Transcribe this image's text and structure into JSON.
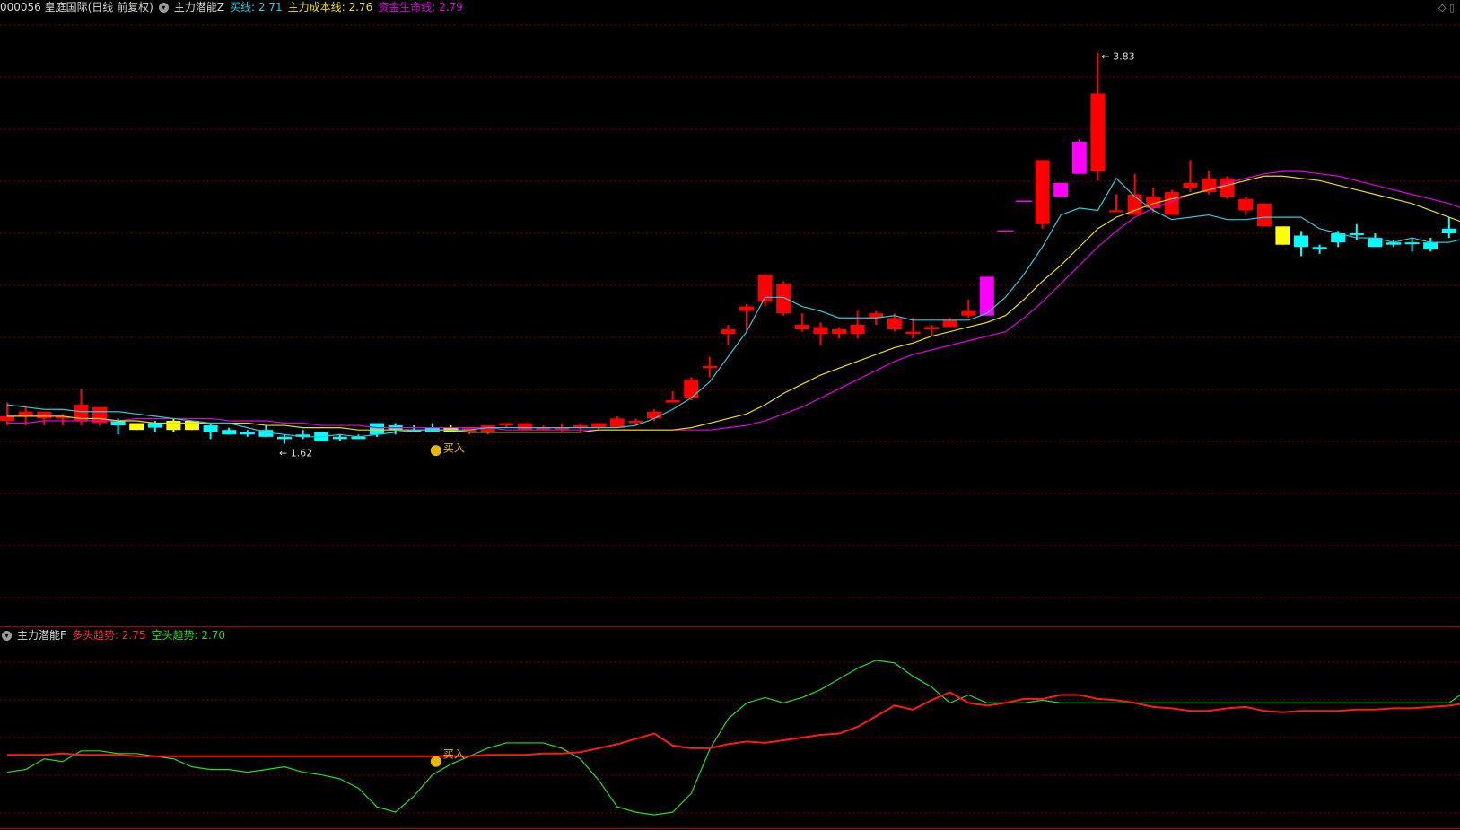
{
  "colors": {
    "up": "#ff0000",
    "down": "#00ffff",
    "warn": "#ffff00",
    "spec": "#ff00ff",
    "grid": "#7a0000",
    "buy_line": "#33c8d8",
    "cost_line": "#e8e000",
    "life_line": "#e000e0",
    "bull": "#ff1a1a",
    "bear": "#22dd22"
  },
  "header": {
    "stock": "000056 皇庭国际(日线 前复权)",
    "indicator": "主力潜能Z",
    "buy_line": "买线: 2.71",
    "cost_line": "主力成本线: 2.76",
    "life_line": "资金生命线: 2.79"
  },
  "sub_header": {
    "indicator": "主力潜能F",
    "bull": "多头趋势: 2.75",
    "bear": "空头趋势: 2.70"
  },
  "annotations": {
    "high": "3.83",
    "low": "1.62",
    "buy_main": "买入",
    "buy_sub": "买入"
  },
  "icons": {
    "indicator_toggle": "chevron-down-icon",
    "buy_signal": "money-bag-icon",
    "corner": "diamond-icon"
  },
  "chart_data": {
    "type": "candlestick",
    "ylim": [
      1.4,
      3.95
    ],
    "candles": [
      {
        "o": 2.22,
        "h": 2.3,
        "l": 2.2,
        "c": 2.24,
        "k": "up"
      },
      {
        "o": 2.24,
        "h": 2.28,
        "l": 2.2,
        "c": 2.26,
        "k": "up"
      },
      {
        "o": 2.23,
        "h": 2.26,
        "l": 2.2,
        "c": 2.26,
        "k": "up"
      },
      {
        "o": 2.23,
        "h": 2.25,
        "l": 2.2,
        "c": 2.24,
        "k": "up"
      },
      {
        "o": 2.22,
        "h": 2.36,
        "l": 2.2,
        "c": 2.29,
        "k": "up"
      },
      {
        "o": 2.21,
        "h": 2.26,
        "l": 2.2,
        "c": 2.28,
        "k": "up"
      },
      {
        "o": 2.2,
        "h": 2.23,
        "l": 2.16,
        "c": 2.22,
        "k": "down"
      },
      {
        "o": 2.18,
        "h": 2.21,
        "l": 2.18,
        "c": 2.21,
        "k": "warn"
      },
      {
        "o": 2.21,
        "h": 2.22,
        "l": 2.17,
        "c": 2.19,
        "k": "down"
      },
      {
        "o": 2.18,
        "h": 2.23,
        "l": 2.17,
        "c": 2.22,
        "k": "warn"
      },
      {
        "o": 2.18,
        "h": 2.22,
        "l": 2.18,
        "c": 2.22,
        "k": "warn"
      },
      {
        "o": 2.2,
        "h": 2.21,
        "l": 2.14,
        "c": 2.17,
        "k": "down"
      },
      {
        "o": 2.18,
        "h": 2.19,
        "l": 2.16,
        "c": 2.16,
        "k": "down"
      },
      {
        "o": 2.17,
        "h": 2.18,
        "l": 2.15,
        "c": 2.16,
        "k": "down"
      },
      {
        "o": 2.18,
        "h": 2.2,
        "l": 2.15,
        "c": 2.15,
        "k": "down"
      },
      {
        "o": 2.15,
        "h": 2.16,
        "l": 2.12,
        "c": 2.14,
        "k": "down"
      },
      {
        "o": 2.16,
        "h": 2.18,
        "l": 2.14,
        "c": 2.15,
        "k": "down"
      },
      {
        "o": 2.17,
        "h": 2.17,
        "l": 2.13,
        "c": 2.13,
        "k": "down"
      },
      {
        "o": 2.15,
        "h": 2.16,
        "l": 2.13,
        "c": 2.14,
        "k": "down"
      },
      {
        "o": 2.15,
        "h": 2.16,
        "l": 2.14,
        "c": 2.14,
        "k": "down"
      },
      {
        "o": 2.16,
        "h": 2.21,
        "l": 2.15,
        "c": 2.21,
        "k": "down"
      },
      {
        "o": 2.2,
        "h": 2.21,
        "l": 2.16,
        "c": 2.18,
        "k": "down"
      },
      {
        "o": 2.18,
        "h": 2.2,
        "l": 2.17,
        "c": 2.18,
        "k": "down"
      },
      {
        "o": 2.19,
        "h": 2.21,
        "l": 2.17,
        "c": 2.17,
        "k": "down"
      },
      {
        "o": 2.19,
        "h": 2.2,
        "l": 2.17,
        "c": 2.17,
        "k": "warn"
      },
      {
        "o": 2.17,
        "h": 2.19,
        "l": 2.16,
        "c": 2.19,
        "k": "up"
      },
      {
        "o": 2.17,
        "h": 2.2,
        "l": 2.16,
        "c": 2.2,
        "k": "up"
      },
      {
        "o": 2.2,
        "h": 2.21,
        "l": 2.19,
        "c": 2.21,
        "k": "up"
      },
      {
        "o": 2.18,
        "h": 2.21,
        "l": 2.18,
        "c": 2.21,
        "k": "up"
      },
      {
        "o": 2.19,
        "h": 2.2,
        "l": 2.18,
        "c": 2.19,
        "k": "up"
      },
      {
        "o": 2.19,
        "h": 2.21,
        "l": 2.17,
        "c": 2.19,
        "k": "up"
      },
      {
        "o": 2.2,
        "h": 2.21,
        "l": 2.17,
        "c": 2.19,
        "k": "up"
      },
      {
        "o": 2.19,
        "h": 2.21,
        "l": 2.18,
        "c": 2.21,
        "k": "up"
      },
      {
        "o": 2.19,
        "h": 2.24,
        "l": 2.19,
        "c": 2.23,
        "k": "up"
      },
      {
        "o": 2.21,
        "h": 2.23,
        "l": 2.2,
        "c": 2.22,
        "k": "up"
      },
      {
        "o": 2.23,
        "h": 2.27,
        "l": 2.22,
        "c": 2.26,
        "k": "up"
      },
      {
        "o": 2.3,
        "h": 2.35,
        "l": 2.3,
        "c": 2.31,
        "k": "up"
      },
      {
        "o": 2.32,
        "h": 2.41,
        "l": 2.31,
        "c": 2.4,
        "k": "up"
      },
      {
        "o": 2.46,
        "h": 2.5,
        "l": 2.41,
        "c": 2.45,
        "k": "up"
      },
      {
        "o": 2.6,
        "h": 2.64,
        "l": 2.55,
        "c": 2.62,
        "k": "up"
      },
      {
        "o": 2.7,
        "h": 2.73,
        "l": 2.61,
        "c": 2.72,
        "k": "up"
      },
      {
        "o": 2.74,
        "h": 2.86,
        "l": 2.72,
        "c": 2.86,
        "k": "up"
      },
      {
        "o": 2.69,
        "h": 2.83,
        "l": 2.68,
        "c": 2.82,
        "k": "up"
      },
      {
        "o": 2.64,
        "h": 2.69,
        "l": 2.61,
        "c": 2.62,
        "k": "up"
      },
      {
        "o": 2.6,
        "h": 2.65,
        "l": 2.55,
        "c": 2.63,
        "k": "up"
      },
      {
        "o": 2.6,
        "h": 2.63,
        "l": 2.58,
        "c": 2.62,
        "k": "up"
      },
      {
        "o": 2.6,
        "h": 2.7,
        "l": 2.58,
        "c": 2.64,
        "k": "up"
      },
      {
        "o": 2.67,
        "h": 2.7,
        "l": 2.64,
        "c": 2.69,
        "k": "up"
      },
      {
        "o": 2.62,
        "h": 2.69,
        "l": 2.61,
        "c": 2.67,
        "k": "up"
      },
      {
        "o": 2.6,
        "h": 2.67,
        "l": 2.58,
        "c": 2.61,
        "k": "up"
      },
      {
        "o": 2.62,
        "h": 2.64,
        "l": 2.59,
        "c": 2.63,
        "k": "up"
      },
      {
        "o": 2.63,
        "h": 2.67,
        "l": 2.63,
        "c": 2.66,
        "k": "up"
      },
      {
        "o": 2.68,
        "h": 2.75,
        "l": 2.67,
        "c": 2.7,
        "k": "up"
      },
      {
        "o": 2.68,
        "h": 2.85,
        "l": 2.68,
        "c": 2.85,
        "k": "spec"
      },
      {
        "o": 3.05,
        "h": 3.05,
        "l": 3.05,
        "c": 3.05,
        "k": "dash"
      },
      {
        "o": 3.18,
        "h": 3.18,
        "l": 3.18,
        "c": 3.18,
        "k": "dash"
      },
      {
        "o": 3.08,
        "h": 3.36,
        "l": 3.06,
        "c": 3.36,
        "k": "up"
      },
      {
        "o": 3.2,
        "h": 3.26,
        "l": 3.2,
        "c": 3.26,
        "k": "spec"
      },
      {
        "o": 3.3,
        "h": 3.45,
        "l": 3.3,
        "c": 3.44,
        "k": "spec"
      },
      {
        "o": 3.31,
        "h": 3.83,
        "l": 3.27,
        "c": 3.65,
        "k": "up"
      },
      {
        "o": 3.14,
        "h": 3.21,
        "l": 3.14,
        "c": 3.14,
        "k": "up"
      },
      {
        "o": 3.12,
        "h": 3.3,
        "l": 3.12,
        "c": 3.21,
        "k": "up"
      },
      {
        "o": 3.15,
        "h": 3.24,
        "l": 3.13,
        "c": 3.2,
        "k": "up"
      },
      {
        "o": 3.12,
        "h": 3.23,
        "l": 3.12,
        "c": 3.22,
        "k": "up"
      },
      {
        "o": 3.24,
        "h": 3.36,
        "l": 3.22,
        "c": 3.26,
        "k": "up"
      },
      {
        "o": 3.22,
        "h": 3.31,
        "l": 3.21,
        "c": 3.28,
        "k": "up"
      },
      {
        "o": 3.2,
        "h": 3.29,
        "l": 3.19,
        "c": 3.28,
        "k": "up"
      },
      {
        "o": 3.14,
        "h": 3.2,
        "l": 3.12,
        "c": 3.19,
        "k": "up"
      },
      {
        "o": 3.07,
        "h": 3.17,
        "l": 3.07,
        "c": 3.17,
        "k": "up"
      },
      {
        "o": 2.99,
        "h": 3.07,
        "l": 2.99,
        "c": 3.07,
        "k": "warn"
      },
      {
        "o": 3.03,
        "h": 3.05,
        "l": 2.94,
        "c": 2.98,
        "k": "down"
      },
      {
        "o": 2.98,
        "h": 2.99,
        "l": 2.95,
        "c": 2.97,
        "k": "down"
      },
      {
        "o": 3.04,
        "h": 3.05,
        "l": 2.98,
        "c": 3.0,
        "k": "down"
      },
      {
        "o": 3.04,
        "h": 3.08,
        "l": 3.01,
        "c": 3.04,
        "k": "down"
      },
      {
        "o": 3.02,
        "h": 3.04,
        "l": 2.98,
        "c": 2.98,
        "k": "down"
      },
      {
        "o": 3.0,
        "h": 3.01,
        "l": 2.98,
        "c": 2.99,
        "k": "down"
      },
      {
        "o": 3.0,
        "h": 3.02,
        "l": 2.96,
        "c": 3.0,
        "k": "down"
      },
      {
        "o": 3.0,
        "h": 3.02,
        "l": 2.96,
        "c": 2.97,
        "k": "down"
      },
      {
        "o": 3.06,
        "h": 3.11,
        "l": 3.02,
        "c": 3.04,
        "k": "down"
      },
      {
        "o": 3.07,
        "h": 3.08,
        "l": 3.05,
        "c": 3.05,
        "k": "down"
      }
    ],
    "buy_line": [
      2.29,
      2.28,
      2.27,
      2.27,
      2.26,
      2.26,
      2.26,
      2.25,
      2.24,
      2.23,
      2.22,
      2.21,
      2.21,
      2.19,
      2.17,
      2.16,
      2.15,
      2.15,
      2.16,
      2.15,
      2.16,
      2.17,
      2.18,
      2.18,
      2.18,
      2.18,
      2.19,
      2.19,
      2.19,
      2.19,
      2.19,
      2.19,
      2.19,
      2.19,
      2.2,
      2.23,
      2.27,
      2.32,
      2.39,
      2.5,
      2.61,
      2.76,
      2.76,
      2.72,
      2.7,
      2.67,
      2.67,
      2.67,
      2.68,
      2.66,
      2.66,
      2.66,
      2.66,
      2.69,
      2.76,
      2.86,
      2.98,
      3.12,
      3.15,
      3.14,
      3.28,
      3.2,
      3.14,
      3.1,
      3.11,
      3.12,
      3.1,
      3.1,
      3.11,
      3.11,
      3.11,
      3.06,
      3.04,
      3.02,
      3.02,
      3.0,
      3.02,
      3.0,
      3.0,
      3.02,
      3.06
    ],
    "cost_line": [
      2.24,
      2.24,
      2.24,
      2.24,
      2.23,
      2.23,
      2.22,
      2.22,
      2.21,
      2.21,
      2.21,
      2.21,
      2.21,
      2.21,
      2.2,
      2.2,
      2.19,
      2.19,
      2.19,
      2.18,
      2.18,
      2.18,
      2.18,
      2.18,
      2.18,
      2.17,
      2.17,
      2.17,
      2.17,
      2.17,
      2.17,
      2.17,
      2.18,
      2.18,
      2.18,
      2.18,
      2.18,
      2.19,
      2.21,
      2.23,
      2.25,
      2.29,
      2.34,
      2.38,
      2.42,
      2.45,
      2.48,
      2.51,
      2.54,
      2.56,
      2.59,
      2.61,
      2.63,
      2.65,
      2.68,
      2.75,
      2.83,
      2.9,
      2.98,
      3.06,
      3.11,
      3.14,
      3.17,
      3.19,
      3.21,
      3.23,
      3.25,
      3.27,
      3.29,
      3.29,
      3.28,
      3.27,
      3.25,
      3.23,
      3.21,
      3.19,
      3.17,
      3.14,
      3.11,
      3.08,
      3.06
    ],
    "life_line": [
      2.21,
      2.21,
      2.22,
      2.22,
      2.22,
      2.22,
      2.22,
      2.23,
      2.23,
      2.23,
      2.23,
      2.23,
      2.22,
      2.22,
      2.22,
      2.21,
      2.21,
      2.2,
      2.2,
      2.2,
      2.19,
      2.19,
      2.19,
      2.19,
      2.19,
      2.19,
      2.19,
      2.18,
      2.18,
      2.18,
      2.18,
      2.18,
      2.18,
      2.18,
      2.18,
      2.18,
      2.18,
      2.18,
      2.18,
      2.19,
      2.2,
      2.22,
      2.25,
      2.28,
      2.32,
      2.36,
      2.4,
      2.44,
      2.48,
      2.51,
      2.53,
      2.55,
      2.57,
      2.59,
      2.61,
      2.67,
      2.74,
      2.82,
      2.9,
      2.98,
      3.05,
      3.11,
      3.15,
      3.18,
      3.21,
      3.23,
      3.26,
      3.28,
      3.3,
      3.31,
      3.31,
      3.3,
      3.29,
      3.27,
      3.25,
      3.23,
      3.21,
      3.19,
      3.17,
      3.14,
      3.12
    ],
    "bull_trend": [
      2.21,
      2.21,
      2.21,
      2.22,
      2.21,
      2.21,
      2.21,
      2.2,
      2.2,
      2.2,
      2.2,
      2.2,
      2.2,
      2.2,
      2.2,
      2.2,
      2.2,
      2.2,
      2.2,
      2.2,
      2.2,
      2.2,
      2.2,
      2.2,
      2.2,
      2.2,
      2.21,
      2.21,
      2.21,
      2.22,
      2.22,
      2.23,
      2.26,
      2.29,
      2.33,
      2.37,
      2.28,
      2.26,
      2.26,
      2.29,
      2.31,
      2.3,
      2.32,
      2.34,
      2.36,
      2.37,
      2.42,
      2.5,
      2.58,
      2.55,
      2.62,
      2.68,
      2.6,
      2.58,
      2.6,
      2.63,
      2.63,
      2.66,
      2.66,
      2.63,
      2.62,
      2.6,
      2.57,
      2.56,
      2.54,
      2.54,
      2.56,
      2.57,
      2.54,
      2.53,
      2.54,
      2.54,
      2.54,
      2.55,
      2.55,
      2.56,
      2.56,
      2.57,
      2.58,
      2.6,
      2.7,
      2.75
    ],
    "bear_trend": [
      2.08,
      2.1,
      2.18,
      2.16,
      2.24,
      2.24,
      2.22,
      2.22,
      2.2,
      2.18,
      2.12,
      2.1,
      2.1,
      2.08,
      2.1,
      2.12,
      2.08,
      2.06,
      2.03,
      1.96,
      1.82,
      1.78,
      1.9,
      2.06,
      2.14,
      2.2,
      2.26,
      2.3,
      2.3,
      2.3,
      2.26,
      2.18,
      2.02,
      1.82,
      1.78,
      1.76,
      1.78,
      1.92,
      2.25,
      2.48,
      2.6,
      2.64,
      2.6,
      2.64,
      2.7,
      2.78,
      2.86,
      2.92,
      2.9,
      2.8,
      2.72,
      2.6,
      2.66,
      2.6,
      2.6,
      2.6,
      2.62,
      2.6,
      2.6,
      2.6,
      2.6,
      2.6,
      2.6,
      2.6,
      2.6,
      2.6,
      2.6,
      2.6,
      2.6,
      2.6,
      2.6,
      2.6,
      2.6,
      2.6,
      2.6,
      2.6,
      2.6,
      2.6,
      2.6,
      2.7,
      2.7
    ]
  }
}
